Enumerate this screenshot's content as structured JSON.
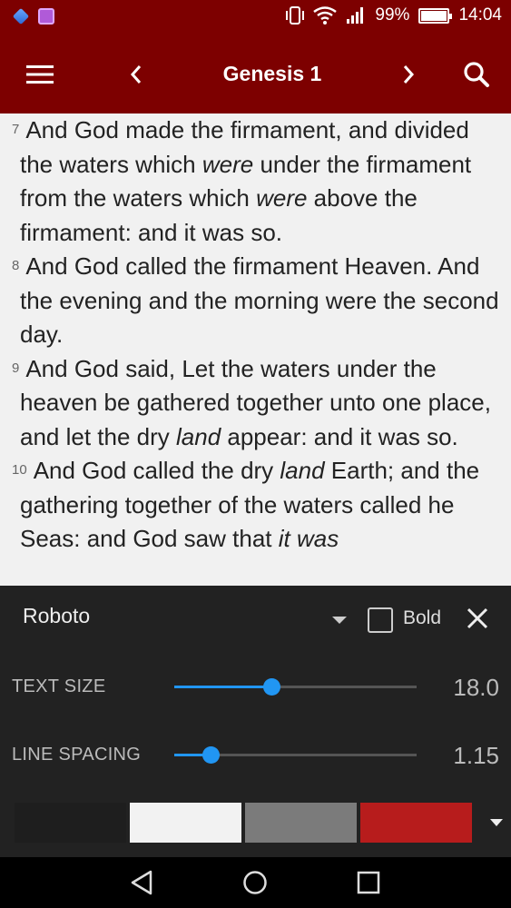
{
  "status_bar": {
    "battery_percent": "99%",
    "battery_level": 0.99,
    "time": "14:04",
    "icons": [
      "dropbox-icon",
      "gallery-icon",
      "vibrate-icon",
      "wifi-icon",
      "signal-icon",
      "battery-icon"
    ]
  },
  "toolbar": {
    "title": "Genesis 1",
    "icons": [
      "menu-icon",
      "chevron-left-icon",
      "chevron-right-icon",
      "search-icon"
    ]
  },
  "reader": {
    "background": "#f1f1f1",
    "verses": [
      {
        "num": "7",
        "segments": [
          {
            "t": "And God made the firmament, and divided the waters which "
          },
          {
            "t": "were",
            "i": true
          },
          {
            "t": " under the firmament from the waters which "
          },
          {
            "t": "were",
            "i": true
          },
          {
            "t": " above the firmament: and it was so."
          }
        ]
      },
      {
        "num": "8",
        "segments": [
          {
            "t": "And God called the firmament Heaven. And the evening and the morning were the second day."
          }
        ]
      },
      {
        "num": "9",
        "segments": [
          {
            "t": "And God said, Let the waters under the heaven be gathered together unto one place, and let the dry "
          },
          {
            "t": "land",
            "i": true
          },
          {
            "t": " appear: and it was so."
          }
        ]
      },
      {
        "num": "10",
        "segments": [
          {
            "t": "And God called the dry "
          },
          {
            "t": "land",
            "i": true
          },
          {
            "t": " Earth; and the gathering together of the waters called he Seas: and God saw that "
          },
          {
            "t": "it was",
            "i": true
          }
        ]
      }
    ]
  },
  "settings": {
    "font_name": "Roboto",
    "bold_label": "Bold",
    "bold_checked": false,
    "text_size_label": "TEXT SIZE",
    "text_size_value": "18.0",
    "text_size_fraction": 0.4,
    "line_spacing_label": "LINE SPACING",
    "line_spacing_value": "1.15",
    "line_spacing_fraction": 0.15,
    "accent_color": "#2196f3",
    "swatches": [
      "#1e1e1e",
      "#f2f2f2",
      "#7b7b7b",
      "#b71c1c"
    ]
  },
  "colors": {
    "brand": "#7d0000",
    "panel": "#222222"
  }
}
